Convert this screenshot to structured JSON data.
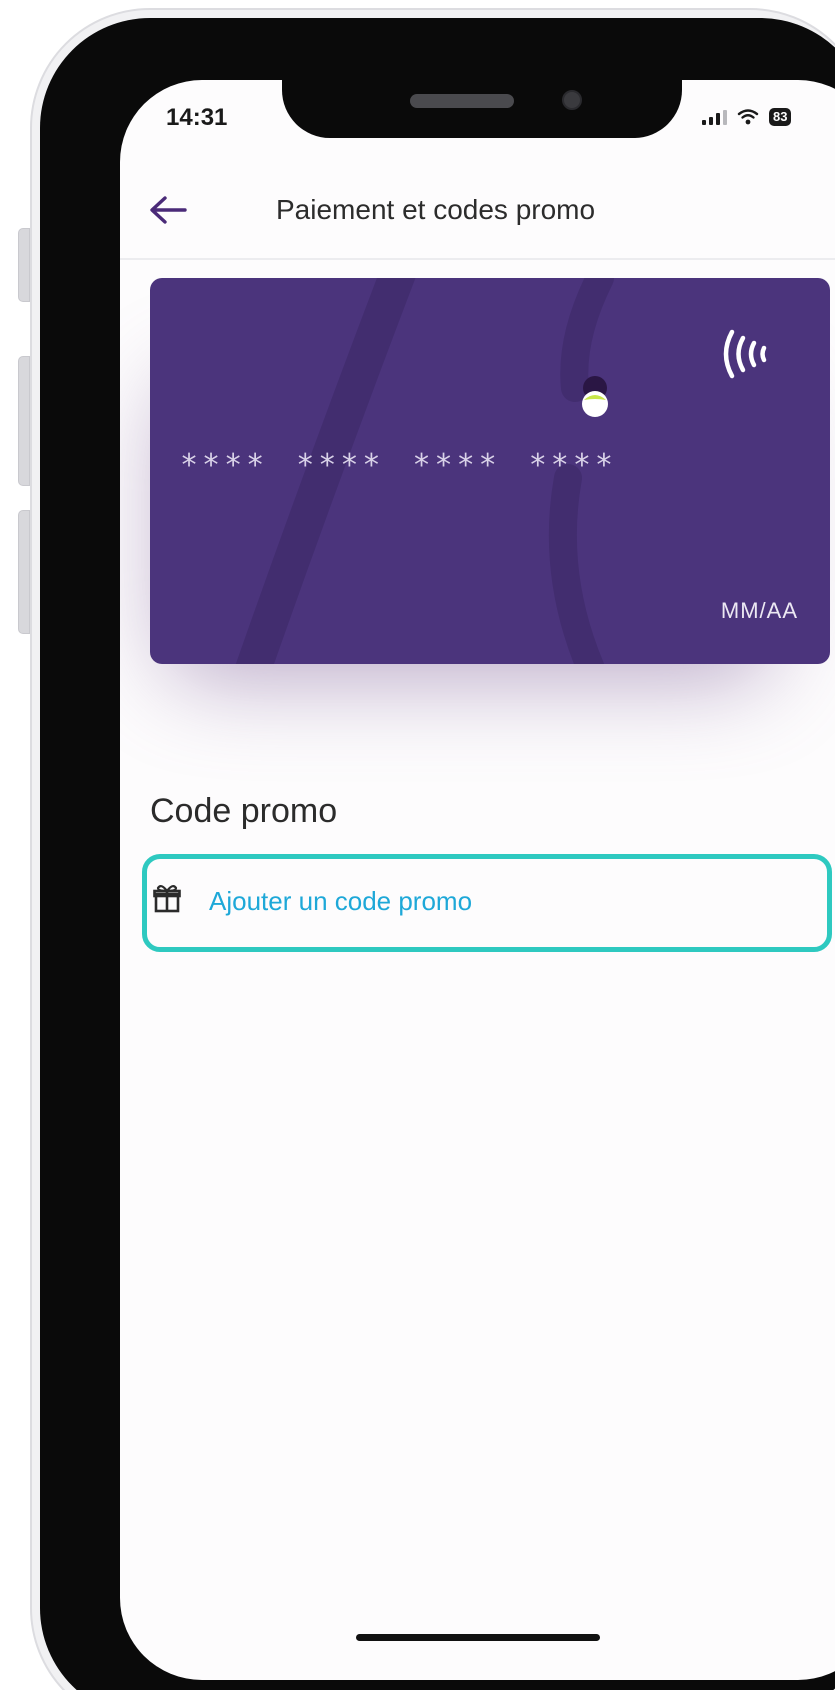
{
  "status_bar": {
    "time": "14:31",
    "battery": "83"
  },
  "header": {
    "back_icon": "arrow-left-icon",
    "title": "Paiement et codes promo"
  },
  "card": {
    "number_groups": [
      "****",
      "****",
      "****",
      "****"
    ],
    "expiry": "MM/AA",
    "contactless_icon": "contactless-icon",
    "colors": {
      "card": "#4b347c",
      "accent_dot": "#c8e64a"
    }
  },
  "promo": {
    "section_title": "Code promo",
    "add_label": "Ajouter un code promo",
    "icon": "gift-icon"
  },
  "colors": {
    "back_arrow": "#4a2a78",
    "link": "#1ea8d8",
    "highlight": "#2ec9c0"
  }
}
